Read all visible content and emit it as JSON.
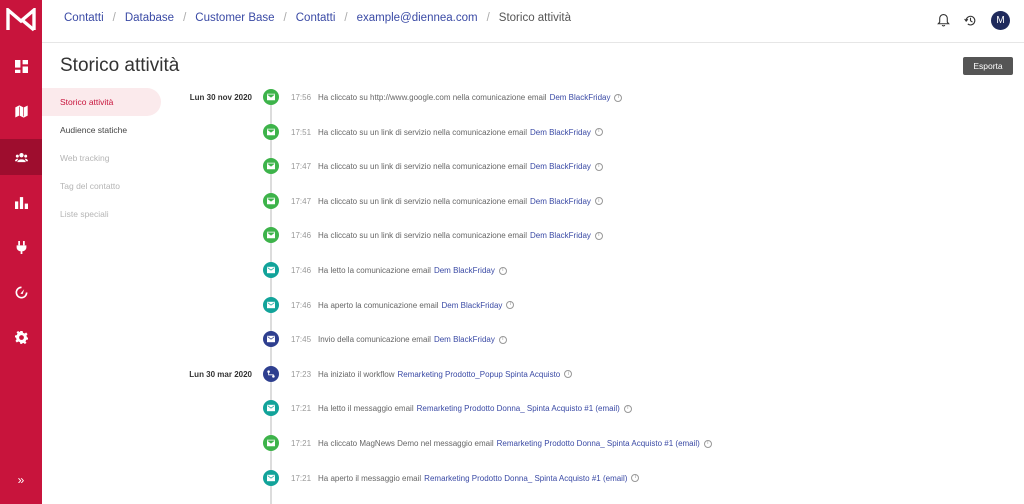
{
  "breadcrumb": [
    "Contatti",
    "Database",
    "Customer Base",
    "Contatti",
    "example@diennea.com",
    "Storico attività"
  ],
  "avatar_initial": "M",
  "page_title": "Storico attività",
  "export_label": "Esporta",
  "subnav": [
    {
      "label": "Storico attività",
      "state": "active"
    },
    {
      "label": "Audience statiche",
      "state": "normal"
    },
    {
      "label": "Web tracking",
      "state": "disabled"
    },
    {
      "label": "Tag del contatto",
      "state": "disabled"
    },
    {
      "label": "Liste speciali",
      "state": "disabled"
    }
  ],
  "expand_label": "»",
  "timeline": [
    {
      "date": "Lun 30 nov 2020",
      "time": "17:56",
      "text": "Ha cliccato su http://www.google.com nella comunicazione email",
      "link": "Dem BlackFriday",
      "icon": "mail-icon",
      "color": "#3db34a"
    },
    {
      "date": "",
      "time": "17:51",
      "text": "Ha cliccato su un link di servizio nella comunicazione email",
      "link": "Dem BlackFriday",
      "icon": "mail-icon",
      "color": "#3db34a"
    },
    {
      "date": "",
      "time": "17:47",
      "text": "Ha cliccato su un link di servizio nella comunicazione email",
      "link": "Dem BlackFriday",
      "icon": "mail-icon",
      "color": "#3db34a"
    },
    {
      "date": "",
      "time": "17:47",
      "text": "Ha cliccato su un link di servizio nella comunicazione email",
      "link": "Dem BlackFriday",
      "icon": "mail-icon",
      "color": "#3db34a"
    },
    {
      "date": "",
      "time": "17:46",
      "text": "Ha cliccato su un link di servizio nella comunicazione email",
      "link": "Dem BlackFriday",
      "icon": "mail-icon",
      "color": "#3db34a"
    },
    {
      "date": "",
      "time": "17:46",
      "text": "Ha letto la comunicazione email",
      "link": "Dem BlackFriday",
      "icon": "mail-open-icon",
      "color": "#12a39a"
    },
    {
      "date": "",
      "time": "17:46",
      "text": "Ha aperto la comunicazione email",
      "link": "Dem BlackFriday",
      "icon": "mail-open-icon",
      "color": "#12a39a"
    },
    {
      "date": "",
      "time": "17:45",
      "text": "Invio della comunicazione email",
      "link": "Dem BlackFriday",
      "icon": "mail-send-icon",
      "color": "#2e3f8f"
    },
    {
      "date": "Lun 30 mar 2020",
      "time": "17:23",
      "text": "Ha iniziato il workflow",
      "link": "Remarketing Prodotto_Popup Spinta Acquisto",
      "icon": "workflow-icon",
      "color": "#2e3f8f"
    },
    {
      "date": "",
      "time": "17:21",
      "text": "Ha letto il messaggio email",
      "link": "Remarketing Prodotto Donna_ Spinta Acquisto #1 (email)",
      "icon": "mail-open-icon",
      "color": "#12a39a"
    },
    {
      "date": "",
      "time": "17:21",
      "text": "Ha cliccato MagNews Demo nel messaggio email",
      "link": "Remarketing Prodotto Donna_ Spinta Acquisto #1 (email)",
      "icon": "mail-icon",
      "color": "#3db34a"
    },
    {
      "date": "",
      "time": "17:21",
      "text": "Ha aperto il messaggio email",
      "link": "Remarketing Prodotto Donna_ Spinta Acquisto #1 (email)",
      "icon": "mail-open-icon",
      "color": "#12a39a"
    }
  ]
}
